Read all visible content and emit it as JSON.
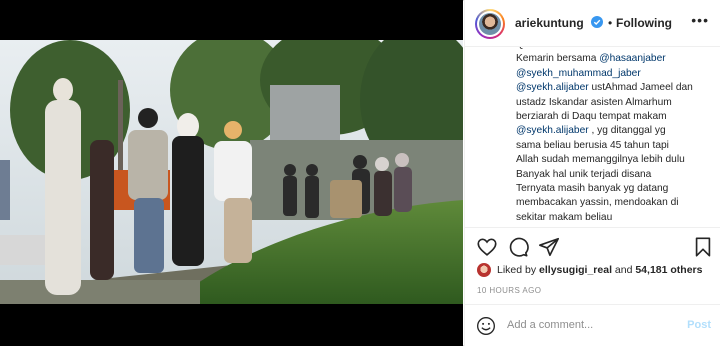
{
  "post": {
    "username": "ariekuntung",
    "follow_status": "Following",
    "caption_lines": [
      [
        {
          "t": "Qasaruain"
        }
      ],
      [
        {
          "t": "Kemarin bersama "
        },
        {
          "t": "@hasaanjaber",
          "m": true
        }
      ],
      [
        {
          "t": "@syekh_muhammad_jaber",
          "m": true
        }
      ],
      [
        {
          "t": "@syekh.alijaber",
          "m": true
        },
        {
          "t": " ustAhmad Jameel dan"
        }
      ],
      [
        {
          "t": "ustadz Iskandar asisten Almarhum"
        }
      ],
      [
        {
          "t": "berziarah di Daqu tempat makam"
        }
      ],
      [
        {
          "t": "@syekh.alijaber",
          "m": true
        },
        {
          "t": " , yg ditanggal yg"
        }
      ],
      [
        {
          "t": "sama beliau berusia 45 tahun tapi"
        }
      ],
      [
        {
          "t": "Allah sudah memanggilnya lebih dulu"
        }
      ],
      [
        {
          "t": "Banyak hal unik terjadi disana"
        }
      ],
      [
        {
          "t": "Ternyata masih banyak yg datang"
        }
      ],
      [
        {
          "t": "membacakan yassin, mendoakan di"
        }
      ],
      [
        {
          "t": "sekitar makam beliau"
        }
      ]
    ],
    "likes": {
      "prefix": "Liked by ",
      "user": "ellysugigi_real",
      "middle": " and ",
      "count": "54,181 others"
    },
    "time_ago": "10 HOURS AGO",
    "comment_placeholder": "Add a comment...",
    "post_label": "Post",
    "more_label": "•••",
    "separator": "•"
  },
  "icons": [
    "verified-badge-icon",
    "heart-icon",
    "comment-icon",
    "share-icon",
    "bookmark-icon",
    "emoji-icon",
    "more-options-icon"
  ],
  "colors": {
    "mention": "#00376b",
    "verified": "#3897f0",
    "post_disabled": "#b2dffc",
    "muted": "#8e8e8e"
  }
}
